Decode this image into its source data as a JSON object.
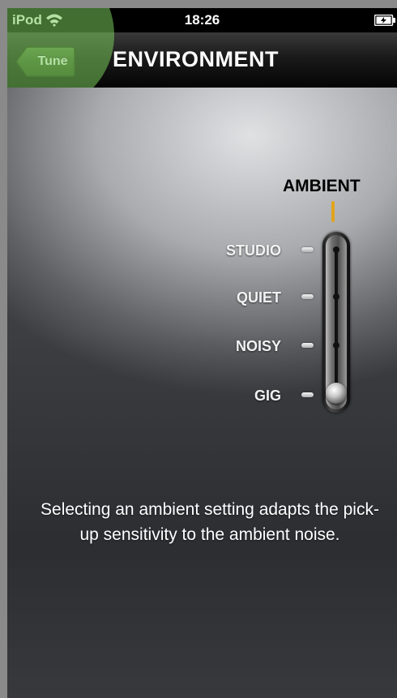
{
  "status_bar": {
    "carrier": "iPod",
    "time": "18:26",
    "wifi_icon": "wifi-icon",
    "battery_icon": "battery-charging-icon"
  },
  "nav_bar": {
    "back_label": "Tune",
    "title": "ENVIRONMENT"
  },
  "ambient": {
    "title": "AMBIENT",
    "levels": [
      "STUDIO",
      "QUIET",
      "NOISY",
      "GIG"
    ],
    "selected": "GIG",
    "pointer_color": "#e2a41b"
  },
  "description": "Selecting an ambient setting adapts the pick-up sensitivity to the ambient noise.",
  "colors": {
    "touch_highlight": "#78c85a",
    "nav_bar": "#1a1a1a"
  }
}
